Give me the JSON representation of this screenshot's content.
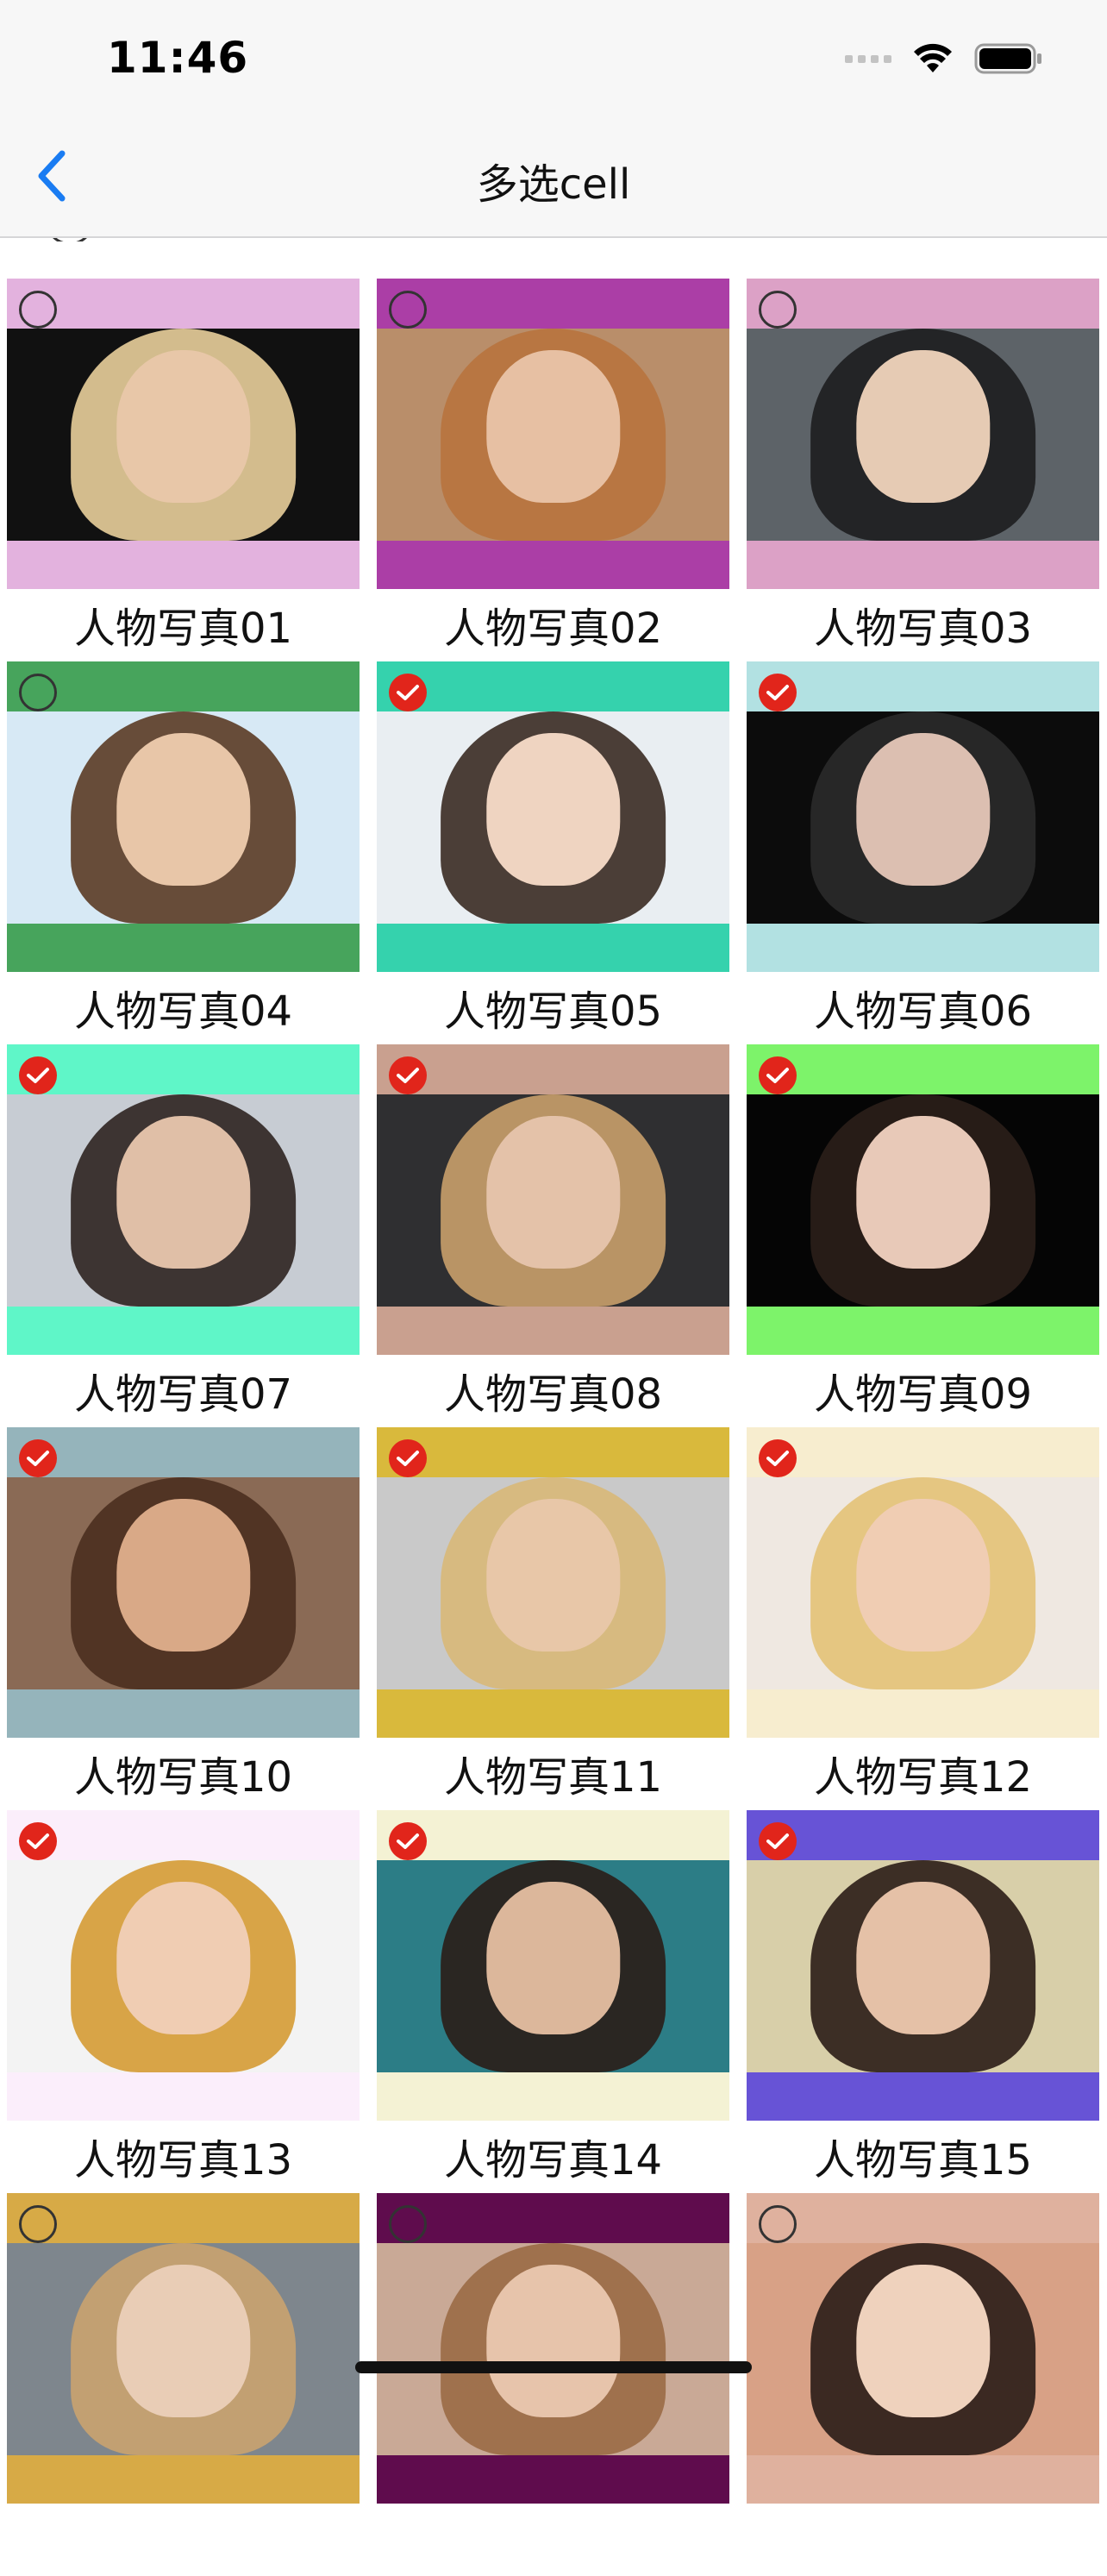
{
  "status_bar": {
    "time": "11:46"
  },
  "nav": {
    "title": "多选cell"
  },
  "cells": [
    {
      "caption": "人物写真01",
      "selected": false,
      "band_color": "#e3b2de",
      "bg": "#111111",
      "face": "#e8c7a8",
      "hair": "#e9cf9b"
    },
    {
      "caption": "人物写真02",
      "selected": false,
      "band_color": "#ab3ea6",
      "bg": "#b98e6a",
      "face": "#e7c0a3",
      "hair": "#b8733e"
    },
    {
      "caption": "人物写真03",
      "selected": false,
      "band_color": "#dca1c6",
      "bg": "#5d6368",
      "face": "#e6cbb4",
      "hair": "#1d1d1f"
    },
    {
      "caption": "人物写真04",
      "selected": false,
      "band_color": "#47a45c",
      "bg": "#d7e9f5",
      "face": "#e8c6a8",
      "hair": "#5b3b25"
    },
    {
      "caption": "人物写真05",
      "selected": true,
      "band_color": "#35d2ad",
      "bg": "#e9eef2",
      "face": "#efd4c1",
      "hair": "#3a2a22"
    },
    {
      "caption": "人物写真06",
      "selected": true,
      "band_color": "#b2e1e2",
      "bg": "#0c0c0c",
      "face": "#dcbfb1",
      "hair": "#2a2a2a"
    },
    {
      "caption": "人物写真07",
      "selected": true,
      "band_color": "#5ff6c8",
      "bg": "#c7ccd3",
      "face": "#e0bfa7",
      "hair": "#2d2320"
    },
    {
      "caption": "人物写真08",
      "selected": true,
      "band_color": "#c9a08f",
      "bg": "#2f2f31",
      "face": "#e4c2a9",
      "hair": "#c9a06c"
    },
    {
      "caption": "人物写真09",
      "selected": true,
      "band_color": "#7df36a",
      "bg": "#050505",
      "face": "#e8c9b8",
      "hair": "#2b1f1a"
    },
    {
      "caption": "人物写真10",
      "selected": true,
      "band_color": "#95b4bb",
      "bg": "#8a6a55",
      "face": "#d9a987",
      "hair": "#4a2f1f"
    },
    {
      "caption": "人物写真11",
      "selected": true,
      "band_color": "#d9b93c",
      "bg": "#c9c9c9",
      "face": "#e8c7a8",
      "hair": "#d8b878"
    },
    {
      "caption": "人物写真12",
      "selected": true,
      "band_color": "#f7edcf",
      "bg": "#efe8e1",
      "face": "#f0cdb3",
      "hair": "#e3c277"
    },
    {
      "caption": "人物写真13",
      "selected": true,
      "band_color": "#fbeefb",
      "bg": "#f3f3f3",
      "face": "#f0cdb3",
      "hair": "#d59b34"
    },
    {
      "caption": "人物写真14",
      "selected": true,
      "band_color": "#f4f2d4",
      "bg": "#2c7d86",
      "face": "#dcb79b",
      "hair": "#2a1d17"
    },
    {
      "caption": "人物写真15",
      "selected": true,
      "band_color": "#6753d6",
      "bg": "#d8cfa9",
      "face": "#e5c1a7",
      "hair": "#2b1c16"
    },
    {
      "caption": "",
      "selected": false,
      "band_color": "#d7aa46",
      "bg": "#7e868d",
      "face": "#e9cdb6",
      "hair": "#caa36f"
    },
    {
      "caption": "",
      "selected": false,
      "band_color": "#5f0c4d",
      "bg": "#c9a996",
      "face": "#e7c4ab",
      "hair": "#9a6a45"
    },
    {
      "caption": "",
      "selected": false,
      "band_color": "#dfb19e",
      "bg": "#d8a186",
      "face": "#efd2bd",
      "hair": "#2a1c17"
    }
  ]
}
